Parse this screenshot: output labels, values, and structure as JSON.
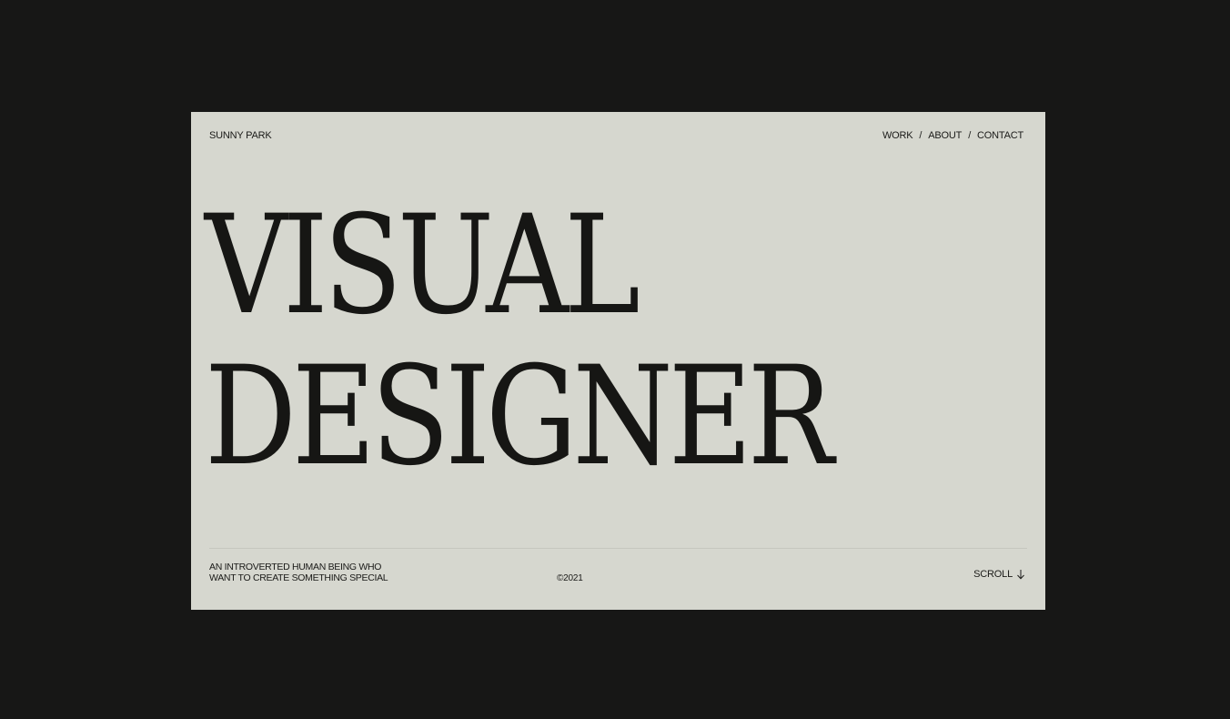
{
  "header": {
    "brand": "SUNNY PARK",
    "nav": [
      {
        "label": "WORK"
      },
      {
        "label": "ABOUT"
      },
      {
        "label": "CONTACT"
      }
    ],
    "separator": "/"
  },
  "hero": {
    "line1": "VISUAL",
    "line2": "DESIGNER"
  },
  "footer": {
    "tagline_line1": "AN INTROVERTED HUMAN BEING WHO",
    "tagline_line2": "WANT TO CREATE SOMETHING SPECIAL",
    "copyright": "©2021",
    "scroll_label": "SCROLL",
    "scroll_icon": "arrow-down-icon"
  },
  "colors": {
    "page_background": "#171716",
    "card_background": "#d6d7cf",
    "text": "#1a1a18"
  }
}
